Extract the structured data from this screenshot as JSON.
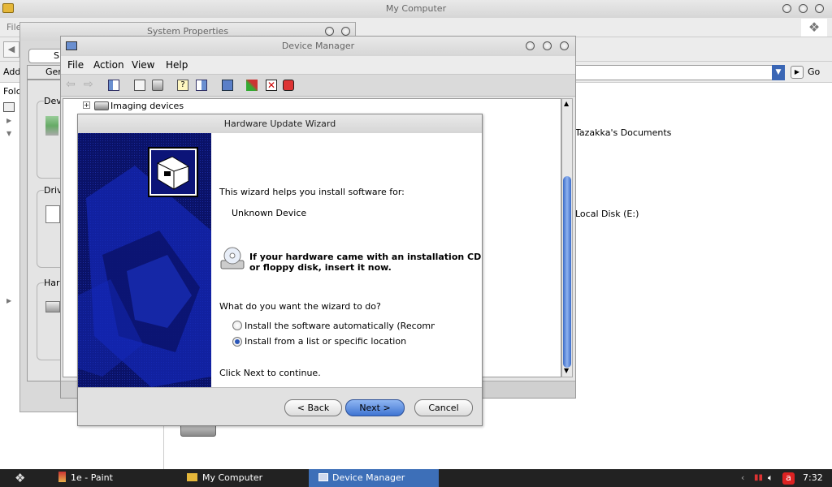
{
  "my_computer": {
    "title": "My Computer",
    "menu_file": "File",
    "address_label": "Add",
    "go_label": "Go",
    "folders_label": "Folc",
    "items": [
      "Tazakka's Documents",
      "Local Disk (E:)"
    ]
  },
  "system_properties": {
    "title": "System Properties",
    "tab_visible": "S",
    "general_tab": "Gen",
    "groups": [
      "Dev",
      "Driv",
      "Hard"
    ]
  },
  "device_manager": {
    "title": "Device Manager",
    "menu": {
      "file": "File",
      "action": "Action",
      "view": "View",
      "help": "Help"
    },
    "tree_item": "Imaging devices"
  },
  "wizard": {
    "title": "Hardware Update Wizard",
    "intro": "This wizard helps you install software for:",
    "device": "Unknown Device",
    "cd_prompt_line1": "If your hardware came with an installation CD",
    "cd_prompt_line2": "or floppy disk, insert it now.",
    "question": "What do you want the wizard to do?",
    "options": [
      {
        "label": "Install the software automatically (Recommended",
        "selected": false
      },
      {
        "label": "Install from a list or specific location",
        "selected": true
      }
    ],
    "continue_text": "Click Next to continue.",
    "back_label": "< Back",
    "next_label": "Next >",
    "cancel_label": "Cancel",
    "accent_color": "#0d1a8a"
  },
  "taskbar": {
    "tasks": [
      "1e - Paint",
      "My Computer",
      "Device Manager"
    ],
    "clock": "7:32"
  }
}
